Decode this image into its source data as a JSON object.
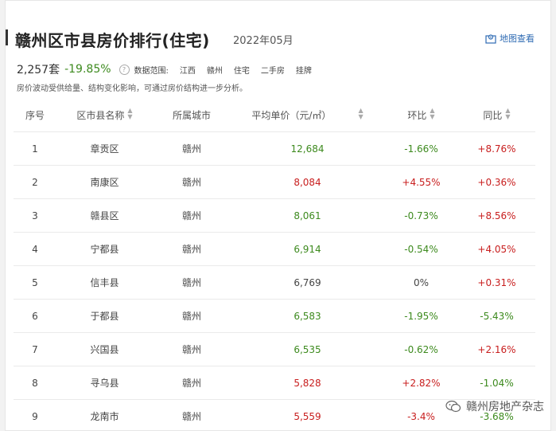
{
  "header": {
    "title": "赣州区市县房价排行(住宅)",
    "period": "2022年05月",
    "map_link": "地图查看"
  },
  "stats": {
    "count": "2,257套",
    "change": "-19.85%",
    "scope_label": "数据范围:",
    "scope": [
      "江西",
      "赣州",
      "住宅",
      "二手房",
      "挂牌"
    ]
  },
  "note": "房价波动受供给量、结构变化影响，可通过房价结构进一步分析。",
  "table": {
    "headers": [
      "序号",
      "区市县名称",
      "所属城市",
      "平均单价（元/㎡）",
      "环比",
      "同比"
    ],
    "rows": [
      {
        "no": "1",
        "name": "章贡区",
        "city": "赣州",
        "price": "12,684",
        "mom": "-1.66%",
        "yoy": "+8.76%",
        "price_color": "#3d8a1e",
        "mom_color": "#3d8a1e",
        "yoy_color": "#c81e1e"
      },
      {
        "no": "2",
        "name": "南康区",
        "city": "赣州",
        "price": "8,084",
        "mom": "+4.55%",
        "yoy": "+0.36%",
        "price_color": "#c81e1e",
        "mom_color": "#c81e1e",
        "yoy_color": "#c81e1e"
      },
      {
        "no": "3",
        "name": "赣县区",
        "city": "赣州",
        "price": "8,061",
        "mom": "-0.73%",
        "yoy": "+8.56%",
        "price_color": "#3d8a1e",
        "mom_color": "#3d8a1e",
        "yoy_color": "#c81e1e"
      },
      {
        "no": "4",
        "name": "宁都县",
        "city": "赣州",
        "price": "6,914",
        "mom": "-0.54%",
        "yoy": "+4.05%",
        "price_color": "#3d8a1e",
        "mom_color": "#3d8a1e",
        "yoy_color": "#c81e1e"
      },
      {
        "no": "5",
        "name": "信丰县",
        "city": "赣州",
        "price": "6,769",
        "mom": "0%",
        "yoy": "+0.31%",
        "price_color": "#444444",
        "mom_color": "#444444",
        "yoy_color": "#c81e1e"
      },
      {
        "no": "6",
        "name": "于都县",
        "city": "赣州",
        "price": "6,583",
        "mom": "-1.95%",
        "yoy": "-5.43%",
        "price_color": "#3d8a1e",
        "mom_color": "#3d8a1e",
        "yoy_color": "#3d8a1e"
      },
      {
        "no": "7",
        "name": "兴国县",
        "city": "赣州",
        "price": "6,535",
        "mom": "-0.62%",
        "yoy": "+2.16%",
        "price_color": "#3d8a1e",
        "mom_color": "#3d8a1e",
        "yoy_color": "#c81e1e"
      },
      {
        "no": "8",
        "name": "寻乌县",
        "city": "赣州",
        "price": "5,828",
        "mom": "+2.82%",
        "yoy": "-1.04%",
        "price_color": "#c81e1e",
        "mom_color": "#c81e1e",
        "yoy_color": "#3d8a1e"
      },
      {
        "no": "9",
        "name": "龙南市",
        "city": "赣州",
        "price": "5,559",
        "mom": "-3.4%",
        "yoy": "-3.68%",
        "price_color": "#c81e1e",
        "mom_color": "#c81e1e",
        "yoy_color": "#3d8a1e"
      }
    ]
  },
  "watermark": "赣州房地产杂志",
  "icons": {
    "map": "map-pin-icon",
    "info": "info-icon",
    "sort": "sort-arrows-icon",
    "watermark": "wechat-icon"
  },
  "colors": {
    "up": "#c81e1e",
    "down": "#3d8a1e",
    "link": "#2f6bb3"
  }
}
